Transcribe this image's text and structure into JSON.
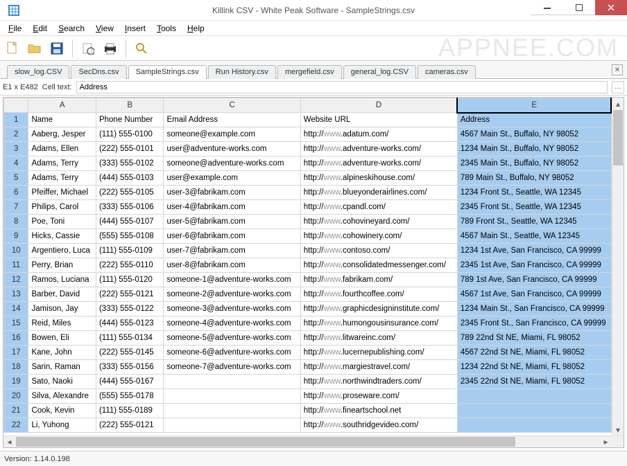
{
  "window": {
    "title": "Killink CSV - White Peak Software - SampleStrings.csv"
  },
  "menu": [
    "File",
    "Edit",
    "Search",
    "View",
    "Insert",
    "Tools",
    "Help"
  ],
  "tabs": {
    "items": [
      "slow_log.CSV",
      "SecDns.csv",
      "SampleStrings.csv",
      "Run History.csv",
      "mergefield.csv",
      "general_log.CSV",
      "cameras.csv"
    ],
    "active_index": 2
  },
  "cellbar": {
    "ref": "E1 x E482",
    "label": "Cell text:",
    "value": "Address"
  },
  "columns": [
    "A",
    "B",
    "C",
    "D",
    "E"
  ],
  "rows": [
    {
      "n": 1,
      "A": "Name",
      "B": "Phone Number",
      "C": "Email Address",
      "D": "Website URL",
      "E": "Address"
    },
    {
      "n": 2,
      "A": "Aaberg, Jesper",
      "B": "(111) 555-0100",
      "C": "someone@example.com",
      "D": "http://www.adatum.com/",
      "E": "4567 Main St., Buffalo, NY 98052"
    },
    {
      "n": 3,
      "A": "Adams, Ellen",
      "B": "(222) 555-0101",
      "C": "user@adventure-works.com",
      "D": "http://www.adventure-works.com/",
      "E": "1234 Main St., Buffalo, NY 98052"
    },
    {
      "n": 4,
      "A": "Adams, Terry",
      "B": "(333) 555-0102",
      "C": "someone@adventure-works.com",
      "D": "http://www.adventure-works.com/",
      "E": "2345 Main St., Buffalo, NY 98052"
    },
    {
      "n": 5,
      "A": "Adams, Terry",
      "B": "(444) 555-0103",
      "C": "user@example.com",
      "D": "http://www.alpineskihouse.com/",
      "E": "789 Main St., Buffalo, NY 98052"
    },
    {
      "n": 6,
      "A": "Pfeiffer, Michael",
      "B": "(222) 555-0105",
      "C": "user-3@fabrikam.com",
      "D": "http://www.blueyonderairlines.com/",
      "E": "1234 Front St., Seattle, WA 12345"
    },
    {
      "n": 7,
      "A": "Philips, Carol",
      "B": "(333) 555-0106",
      "C": "user-4@fabrikam.com",
      "D": "http://www.cpandl.com/",
      "E": "2345 Front St., Seattle, WA 12345"
    },
    {
      "n": 8,
      "A": "Poe, Toni",
      "B": "(444) 555-0107",
      "C": "user-5@fabrikam.com",
      "D": "http://www.cohovineyard.com/",
      "E": "789 Front St., Seattle, WA 12345"
    },
    {
      "n": 9,
      "A": "Hicks, Cassie",
      "B": "(555) 555-0108",
      "C": "user-6@fabrikam.com",
      "D": "http://www.cohowinery.com/",
      "E": "4567 Main St., Seattle, WA 12345"
    },
    {
      "n": 10,
      "A": "Argentiero, Luca",
      "B": "(111) 555-0109",
      "C": "user-7@fabrikam.com",
      "D": "http://www.contoso.com/",
      "E": "1234 1st Ave, San Francisco, CA 99999"
    },
    {
      "n": 11,
      "A": "Perry, Brian",
      "B": "(222) 555-0110",
      "C": "user-8@fabrikam.com",
      "D": "http://www.consolidatedmessenger.com/",
      "E": "2345 1st Ave, San Francisco, CA 99999"
    },
    {
      "n": 12,
      "A": "Ramos, Luciana",
      "B": "(111) 555-0120",
      "C": "someone-1@adventure-works.com",
      "D": "http://www.fabrikam.com/",
      "E": "789 1st Ave, San Francisco, CA 99999"
    },
    {
      "n": 13,
      "A": "Barber, David",
      "B": "(222) 555-0121",
      "C": "someone-2@adventure-works.com",
      "D": "http://www.fourthcoffee.com/",
      "E": "4567 1st Ave, San Francisco, CA 99999"
    },
    {
      "n": 14,
      "A": "Jamison, Jay",
      "B": "(333) 555-0122",
      "C": "someone-3@adventure-works.com",
      "D": "http://www.graphicdesigninstitute.com/",
      "E": "1234 Main St., San Francisco, CA 99999"
    },
    {
      "n": 15,
      "A": "Reid, Miles",
      "B": "(444) 555-0123",
      "C": "someone-4@adventure-works.com",
      "D": "http://www.humongousinsurance.com/",
      "E": "2345 Front St., San Francisco, CA 99999"
    },
    {
      "n": 16,
      "A": "Bowen, Eli",
      "B": "(111) 555-0134",
      "C": "someone-5@adventure-works.com",
      "D": "http://www.litwareinc.com/",
      "E": "789 22nd St NE, Miami, FL 98052"
    },
    {
      "n": 17,
      "A": "Kane, John",
      "B": "(222) 555-0145",
      "C": "someone-6@adventure-works.com",
      "D": "http://www.lucernepublishing.com/",
      "E": "4567 22nd St NE, Miami, FL 98052"
    },
    {
      "n": 18,
      "A": "Sarin, Raman",
      "B": "(333) 555-0156",
      "C": "someone-7@adventure-works.com",
      "D": "http://www.margiestravel.com/",
      "E": "1234 22nd St NE, Miami, FL 98052"
    },
    {
      "n": 19,
      "A": "Sato, Naoki",
      "B": "(444) 555-0167",
      "C": "",
      "D": "http://www.northwindtraders.com/",
      "E": "2345 22nd St NE, Miami, FL 98052"
    },
    {
      "n": 20,
      "A": "Silva, Alexandre",
      "B": "(555) 555-0178",
      "C": "",
      "D": "http://www.proseware.com/",
      "E": ""
    },
    {
      "n": 21,
      "A": "Cook, Kevin",
      "B": "(111) 555-0189",
      "C": "",
      "D": "http://www.fineartschool.net",
      "E": ""
    },
    {
      "n": 22,
      "A": "Li, Yuhong",
      "B": "(222) 555-0121",
      "C": "",
      "D": "http://www.southridgevideo.com/",
      "E": ""
    }
  ],
  "status": {
    "label": "Version:",
    "value": "1.14.0.198"
  },
  "watermark": "APPNEE.COM"
}
